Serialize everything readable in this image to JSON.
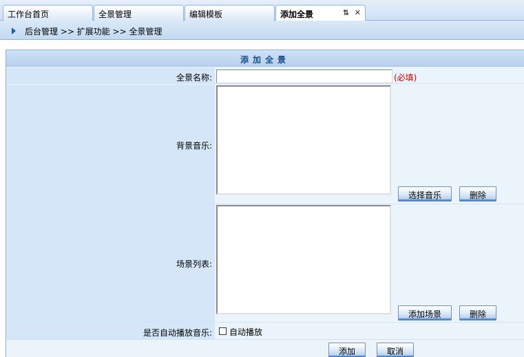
{
  "tabs": [
    {
      "label": "工作台首页"
    },
    {
      "label": "全景管理"
    },
    {
      "label": "编辑模板"
    },
    {
      "label": "添加全景",
      "active": true,
      "refresh_glyph": "⇅",
      "close_glyph": "✕"
    }
  ],
  "breadcrumb": {
    "text": "后台管理 >> 扩展功能 >> 全景管理"
  },
  "form": {
    "title": "添加全景",
    "name_label": "全景名称:",
    "name_value": "",
    "name_required": "(必填)",
    "music_label": "背景音乐:",
    "select_music_button": "选择音乐",
    "delete_music_button": "删除",
    "scene_label": "场景列表:",
    "add_scene_button": "添加场景",
    "delete_scene_button": "删除",
    "autoplay_label": "是否自动播放音乐:",
    "autoplay_checkbox_label": "自动播放",
    "autoplay_checked": false,
    "submit_button": "添加",
    "cancel_button": "取消"
  },
  "colors": {
    "accent": "#1d5ab3",
    "required": "#cc0000",
    "label_bg": "#d5e6f8",
    "value_bg": "#ebf3fb"
  }
}
